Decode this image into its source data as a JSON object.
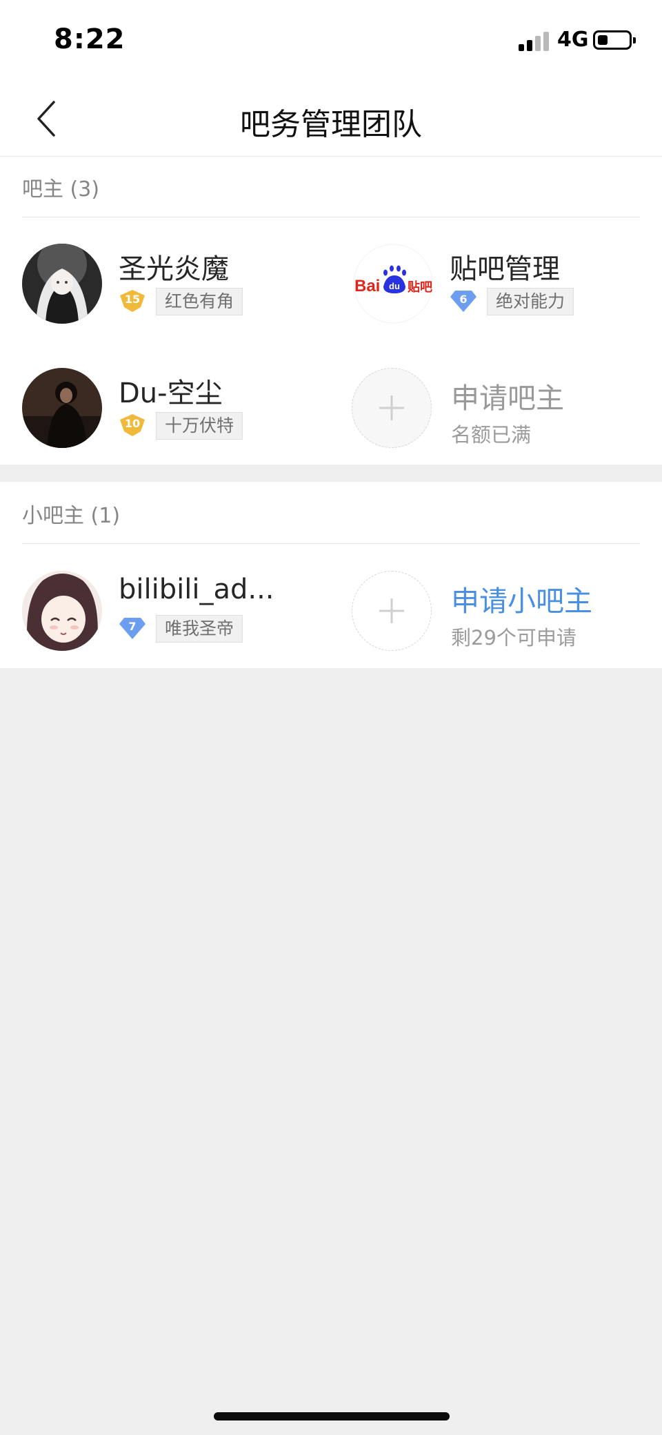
{
  "status_bar": {
    "time": "8:22",
    "network": "4G"
  },
  "nav": {
    "title": "吧务管理团队",
    "back_icon": "chevron-left-icon"
  },
  "owners_section": {
    "title": "吧主 (3)",
    "members": [
      {
        "name": "圣光炎魔",
        "level": "15",
        "level_badge": "gold-shield-icon",
        "tag": "红色有角",
        "avatar": "anime-girl-avatar"
      },
      {
        "name": "贴吧管理",
        "level": "6",
        "level_badge": "blue-diamond-icon",
        "tag": "绝对能力",
        "avatar": "baidu-tieba-logo"
      },
      {
        "name": "Du-空尘",
        "level": "10",
        "level_badge": "gold-shield-icon",
        "tag": "十万伏特",
        "avatar": "dark-photo-avatar"
      }
    ],
    "apply": {
      "label": "申请吧主",
      "sub": "名额已满",
      "icon": "plus-icon"
    }
  },
  "assistants_section": {
    "title": "小吧主 (1)",
    "members": [
      {
        "name": "bilibili_ad...",
        "level": "7",
        "level_badge": "blue-diamond-icon",
        "tag": "唯我圣帝",
        "avatar": "anime-smile-avatar"
      }
    ],
    "apply": {
      "label": "申请小吧主",
      "sub": "剩29个可申请",
      "icon": "plus-icon"
    }
  },
  "logo": {
    "text_bai": "Bai",
    "text_du": "du",
    "text_tieba": "贴吧"
  },
  "colors": {
    "accent_blue": "#4a90e2",
    "disabled_gray": "#999999",
    "gold": "#f0b93a",
    "baidu_red": "#e1251b",
    "baidu_blue": "#2932e1"
  }
}
